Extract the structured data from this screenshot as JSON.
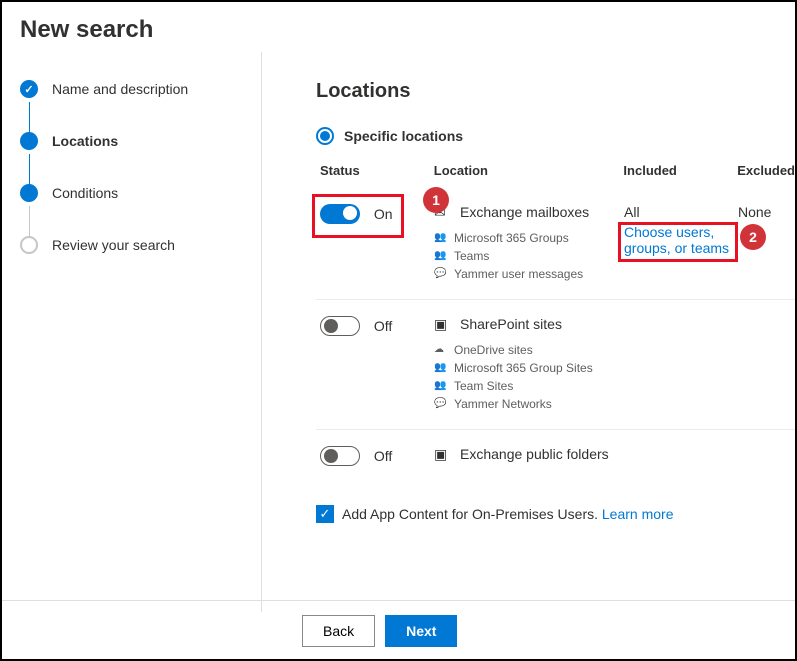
{
  "header": {
    "title": "New search"
  },
  "steps": [
    {
      "label": "Name and description"
    },
    {
      "label": "Locations"
    },
    {
      "label": "Conditions"
    },
    {
      "label": "Review your search"
    }
  ],
  "main": {
    "heading": "Locations",
    "radio_label": "Specific locations",
    "columns": {
      "status": "Status",
      "location": "Location",
      "included": "Included",
      "excluded": "Excluded"
    }
  },
  "rows": {
    "r0": {
      "toggle_state": "On",
      "title": "Exchange mailboxes",
      "subs": {
        "s0": "Microsoft 365 Groups",
        "s1": "Teams",
        "s2": "Yammer user messages"
      },
      "included": "All",
      "included_link": "Choose users, groups, or teams",
      "excluded": "None"
    },
    "r1": {
      "toggle_state": "Off",
      "title": "SharePoint sites",
      "subs": {
        "s0": "OneDrive sites",
        "s1": "Microsoft 365 Group Sites",
        "s2": "Team Sites",
        "s3": "Yammer Networks"
      }
    },
    "r2": {
      "toggle_state": "Off",
      "title": "Exchange public folders"
    }
  },
  "checkbox": {
    "label": "Add App Content for On-Premises Users.",
    "link": "Learn more"
  },
  "footer": {
    "back": "Back",
    "next": "Next"
  },
  "annotations": {
    "a1": "1",
    "a2": "2"
  }
}
